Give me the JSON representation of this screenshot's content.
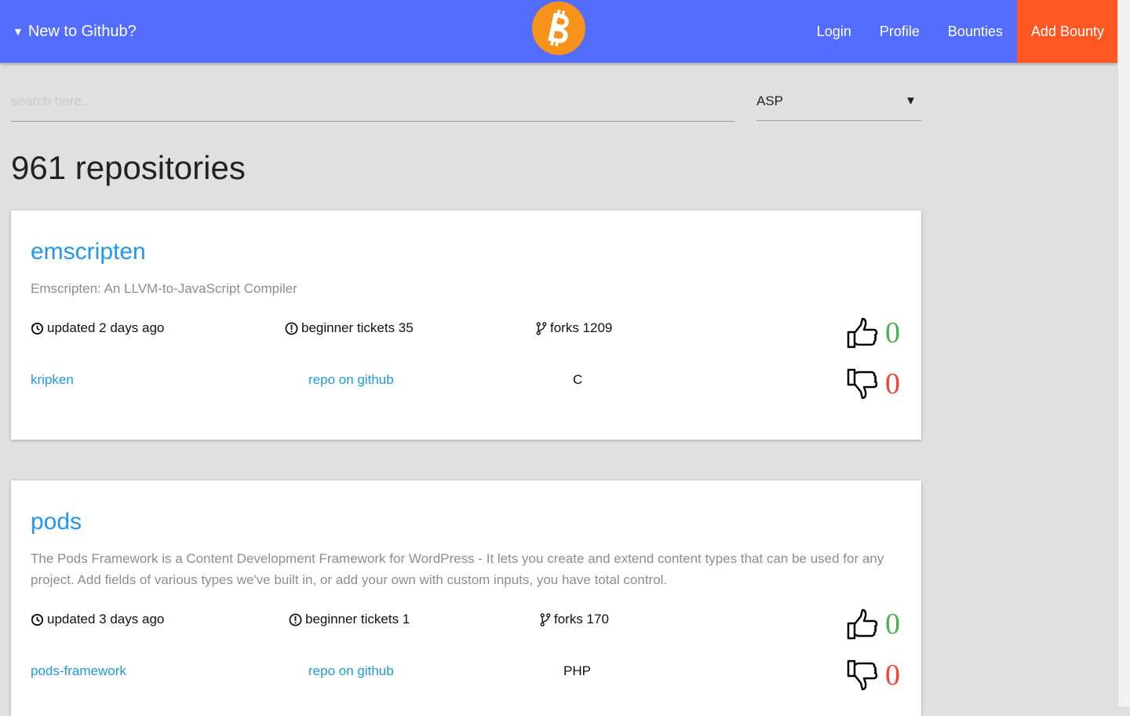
{
  "nav": {
    "menu_label": "New to Github?",
    "links": [
      "Login",
      "Profile",
      "Bounties",
      "Add Bounty"
    ],
    "accent_color": "#ff5722",
    "bar_color": "#536dfe"
  },
  "search": {
    "placeholder": "search here...",
    "value": ""
  },
  "language_filter": {
    "selected": "ASP"
  },
  "results_title": "961 repositories",
  "repos": [
    {
      "name": "emscripten",
      "description": "Emscripten: An LLVM-to-JavaScript Compiler",
      "updated": "updated 2 days ago",
      "tickets": "beginner tickets 35",
      "forks": "forks 1209",
      "owner": "kripken",
      "github_link": "repo on github",
      "language": "C",
      "upvotes": "0",
      "downvotes": "0"
    },
    {
      "name": "pods",
      "description": "The Pods Framework is a Content Development Framework for WordPress - It lets you create and extend content types that can be used for any project. Add fields of various types we've built in, or add your own with custom inputs, you have total control.",
      "updated": "updated 3 days ago",
      "tickets": "beginner tickets 1",
      "forks": "forks 170",
      "owner": "pods-framework",
      "github_link": "repo on github",
      "language": "PHP",
      "upvotes": "0",
      "downvotes": "0"
    }
  ]
}
